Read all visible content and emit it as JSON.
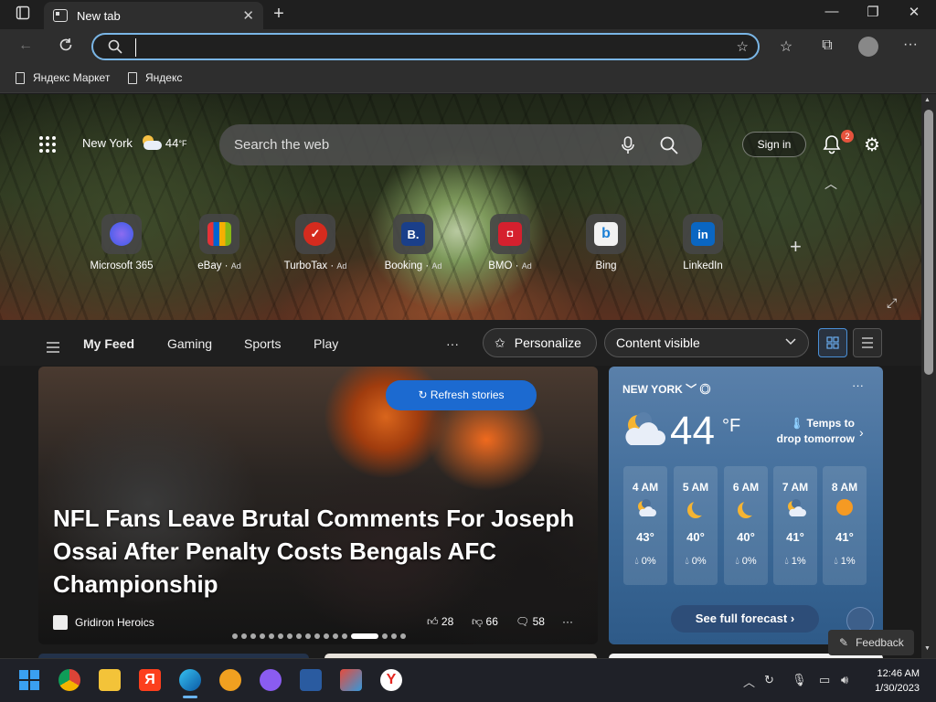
{
  "browser": {
    "tab_title": "New tab",
    "address_value": "",
    "favorites": [
      {
        "label": "Яндекс Маркет"
      },
      {
        "label": "Яндекс"
      }
    ]
  },
  "page": {
    "location": "New York",
    "location_temp": "44",
    "location_unit": "°F",
    "search_placeholder": "Search the web",
    "signin_label": "Sign in",
    "notification_count": "2",
    "quick_links": [
      {
        "label": "Microsoft 365",
        "ad": "",
        "color": "#4a3fa8",
        "glyph": "◉"
      },
      {
        "label": "eBay",
        "ad": "Ad",
        "color": "#2f2f2f",
        "glyph": "🛍"
      },
      {
        "label": "TurboTax",
        "ad": "Ad",
        "color": "#d52b1e",
        "glyph": "✓"
      },
      {
        "label": "Booking",
        "ad": "Ad",
        "color": "#1a3f8a",
        "glyph": "B."
      },
      {
        "label": "BMO",
        "ad": "Ad",
        "color": "#d5202e",
        "glyph": "◘"
      },
      {
        "label": "Bing",
        "ad": "",
        "color": "#f2f2f2",
        "glyph": "b"
      },
      {
        "label": "LinkedIn",
        "ad": "",
        "color": "#0a66c2",
        "glyph": "in"
      }
    ],
    "feed_nav": [
      "My Feed",
      "Gaming",
      "Sports",
      "Play"
    ],
    "more_label": "···",
    "personalize_label": "Personalize",
    "content_select": "Content visible",
    "hero_story": {
      "refresh_label": "Refresh stories",
      "headline": "NFL Fans Leave Brutal Comments For Joseph Ossai After Penalty Costs Bengals AFC Championship",
      "source": "Gridiron Heroics",
      "likes": "28",
      "dislikes": "66",
      "comments": "58"
    },
    "weather": {
      "city": "NEW YORK",
      "temp": "44",
      "unit": "°F",
      "message": "Temps to drop tomorrow",
      "hours": [
        {
          "time": "4 AM",
          "icon": "moon-cloud",
          "temp": "43°",
          "precip": "0%"
        },
        {
          "time": "5 AM",
          "icon": "moon",
          "temp": "40°",
          "precip": "0%"
        },
        {
          "time": "6 AM",
          "icon": "moon",
          "temp": "40°",
          "precip": "0%"
        },
        {
          "time": "7 AM",
          "icon": "moon-cloud",
          "temp": "41°",
          "precip": "1%"
        },
        {
          "time": "8 AM",
          "icon": "sun",
          "temp": "41°",
          "precip": "1%"
        }
      ],
      "forecast_label": "See full forecast"
    },
    "feedback_label": "Feedback"
  },
  "taskbar": {
    "time": "12:46 AM",
    "date": "1/30/2023"
  }
}
